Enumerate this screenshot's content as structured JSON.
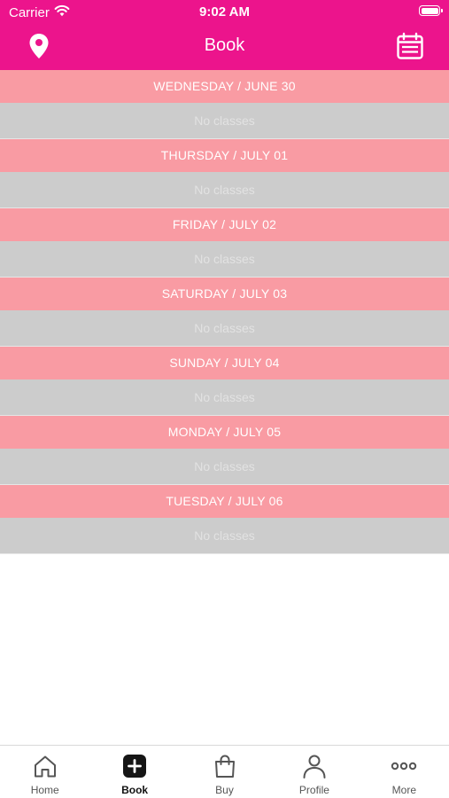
{
  "status_bar": {
    "carrier": "Carrier",
    "time": "9:02 AM",
    "wifi_icon": "wifi-icon",
    "battery_icon": "battery-icon"
  },
  "nav": {
    "title": "Book",
    "left_icon": "location-pin-icon",
    "right_icon": "calendar-icon"
  },
  "days": [
    {
      "header": "WEDNESDAY / JUNE 30",
      "status": "No classes"
    },
    {
      "header": "THURSDAY / JULY 01",
      "status": "No classes"
    },
    {
      "header": "FRIDAY / JULY 02",
      "status": "No classes"
    },
    {
      "header": "SATURDAY / JULY 03",
      "status": "No classes"
    },
    {
      "header": "SUNDAY / JULY 04",
      "status": "No classes"
    },
    {
      "header": "MONDAY / JULY 05",
      "status": "No classes"
    },
    {
      "header": "TUESDAY / JULY 06",
      "status": "No classes"
    }
  ],
  "tabs": [
    {
      "label": "Home",
      "icon": "home-icon"
    },
    {
      "label": "Book",
      "icon": "plus-square-icon",
      "active": true
    },
    {
      "label": "Buy",
      "icon": "shopping-bag-icon"
    },
    {
      "label": "Profile",
      "icon": "user-icon"
    },
    {
      "label": "More",
      "icon": "more-dots-icon"
    }
  ],
  "colors": {
    "header_bg": "#ec148c",
    "day_header_bg": "#f99ba3",
    "empty_row_bg": "#cccccc"
  }
}
